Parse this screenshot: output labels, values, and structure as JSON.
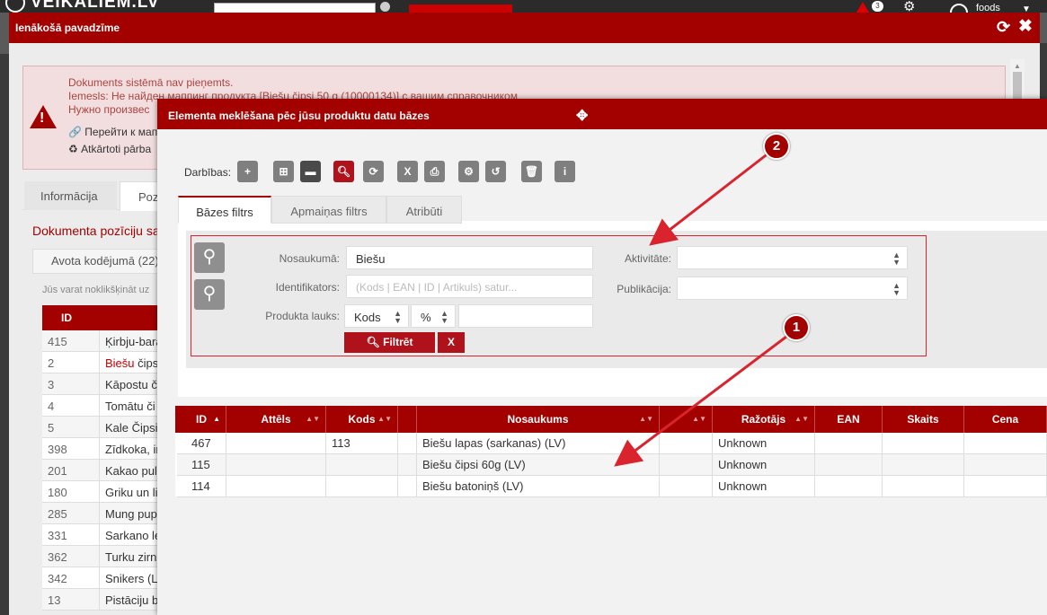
{
  "topbar": {
    "logo": "VEIKALIEM.LV",
    "badge": "3",
    "user": "foods"
  },
  "outer_window": {
    "title": "Ienākošā pavadzīme",
    "alert": {
      "line1": "Dokuments sistēmā nav pieņemts.",
      "line2": "Iemesls: Не найден маппинг продукта [Biešu čipsi 50 g (10000134)] с вашим справочником",
      "line3": "Нужно произвес",
      "link1": "Перейти к мап",
      "link2": "Atkārtoti pārba"
    },
    "tabs": [
      "Informācija",
      "Pozīc"
    ],
    "section_title": "Dokumenta pozīciju sa",
    "sub_tab": "Avota kodējumā (22)",
    "hint": "Jūs varat noklikšķināt uz",
    "table": {
      "header_id": "ID",
      "rows": [
        {
          "id": "415",
          "name": "Ķirbju-bara",
          "highlight": false
        },
        {
          "id": "2",
          "name": "Biešu čips",
          "name_red": "Biešu",
          "name_rest": " čips",
          "highlight": true
        },
        {
          "id": "3",
          "name": "Kāpostu č",
          "highlight": false
        },
        {
          "id": "4",
          "name": "Tomātu či",
          "highlight": false
        },
        {
          "id": "5",
          "name": "Kale Čipsi",
          "highlight": false
        },
        {
          "id": "398",
          "name": "Zīdkoka, ir",
          "highlight": false
        },
        {
          "id": "201",
          "name": "Kakao pul",
          "highlight": false
        },
        {
          "id": "180",
          "name": "Griku un li",
          "highlight": false
        },
        {
          "id": "285",
          "name": "Mung pup",
          "highlight": false
        },
        {
          "id": "331",
          "name": "Sarkano le",
          "highlight": false
        },
        {
          "id": "362",
          "name": "Turku zirn",
          "highlight": false
        },
        {
          "id": "342",
          "name": "Snikers (L",
          "highlight": false
        },
        {
          "id": "13",
          "name": "Pistāciju b",
          "highlight": false
        }
      ]
    }
  },
  "modal": {
    "title": "Elementa meklēšana pēc jūsu produktu datu bāzes",
    "toolbar_label": "Darbības:",
    "toolbar_icons": [
      "plus-icon",
      "sitemap-icon",
      "folder-icon",
      "search-icon",
      "refresh-icon",
      "excel-icon",
      "print-icon",
      "cogs-icon",
      "history-icon",
      "trash-icon",
      "info-icon"
    ],
    "filter_tabs": [
      "Bāzes filtrs",
      "Apmaiņas filtrs",
      "Atribūti"
    ],
    "filters": {
      "nosaukuma_label": "Nosaukumā:",
      "nosaukuma_value": "Biešu",
      "ident_label": "Identifikators:",
      "ident_placeholder": "(Kods | EAN | ID | Artikuls) satur...",
      "lauks_label": "Produkta lauks:",
      "lauks_field": "Kods",
      "lauks_op": "%",
      "aktivitate_label": "Aktivitāte:",
      "publikacija_label": "Publikācija:",
      "filter_button": "Filtrēt",
      "clear_button": "X"
    },
    "grid": {
      "columns": [
        "ID",
        "Attēls",
        "Kods",
        "",
        "Nosaukums",
        "",
        "Ražotājs",
        "EAN",
        "Skaits",
        "Cena"
      ],
      "rows": [
        {
          "id": "467",
          "kods": "113",
          "nosaukums": "Biešu lapas (sarkanas) (LV)",
          "razotajs": "Unknown"
        },
        {
          "id": "115",
          "kods": "",
          "nosaukums": "Biešu čipsi 60g (LV)",
          "razotajs": "Unknown"
        },
        {
          "id": "114",
          "kods": "",
          "nosaukums": "Biešu batoniņš (LV)",
          "razotajs": "Unknown"
        }
      ]
    }
  },
  "callouts": [
    "1",
    "2"
  ],
  "colors": {
    "brand_red": "#a30000",
    "button_red": "#b0121b",
    "alert_bg": "#f2dede"
  }
}
